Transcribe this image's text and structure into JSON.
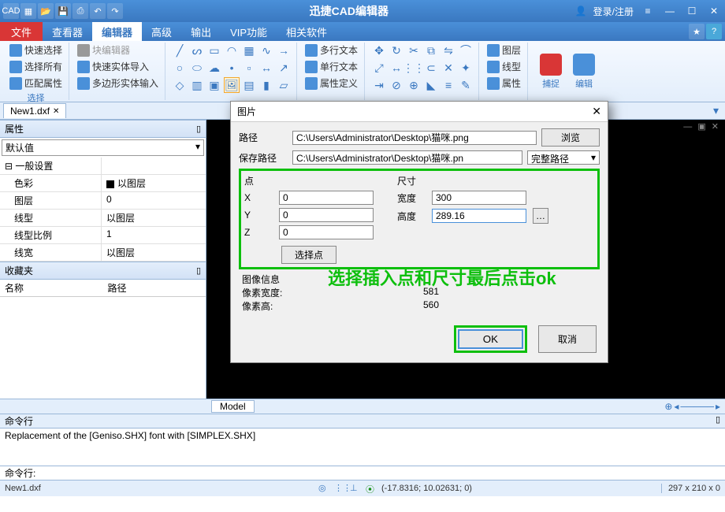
{
  "titlebar": {
    "app_title": "迅捷CAD编辑器",
    "login": "登录/注册"
  },
  "menubar": {
    "file": "文件",
    "tabs": [
      "查看器",
      "编辑器",
      "高级",
      "输出",
      "VIP功能",
      "相关软件"
    ],
    "active_index": 1
  },
  "ribbon": {
    "sel1": "快速选择",
    "sel2": "选择所有",
    "sel3": "匹配属性",
    "sel_grp": "选择",
    "blk1": "块编辑器",
    "blk2": "快速实体导入",
    "blk3": "多边形实体输入",
    "txt1": "多行文本",
    "txt2": "单行文本",
    "txt3": "属性定义",
    "layer1": "图层",
    "layer2": "线型",
    "layer3": "属性",
    "capture": "捕捉",
    "edit": "编辑"
  },
  "doctab": {
    "name": "New1.dxf"
  },
  "props": {
    "header": "属性",
    "default": "默认值",
    "section": "一般设置",
    "rows": [
      {
        "label": "色彩",
        "val": "以图层",
        "swatch": true
      },
      {
        "label": "图层",
        "val": "0"
      },
      {
        "label": "线型",
        "val": "以图层"
      },
      {
        "label": "线型比例",
        "val": "1"
      },
      {
        "label": "线宽",
        "val": "以图层"
      }
    ]
  },
  "fav": {
    "header": "收藏夹",
    "name_hdr": "名称",
    "path_hdr": "路径"
  },
  "dialog": {
    "title": "图片",
    "path_label": "路径",
    "path_val": "C:\\Users\\Administrator\\Desktop\\猫咪.png",
    "browse": "浏览",
    "save_label": "保存路径",
    "save_val": "C:\\Users\\Administrator\\Desktop\\猫咪.pn",
    "save_combo": "完整路径",
    "point_hdr": "点",
    "size_hdr": "尺寸",
    "x": "X",
    "y": "Y",
    "z": "Z",
    "xv": "0",
    "yv": "0",
    "zv": "0",
    "w_label": "宽度",
    "h_label": "高度",
    "wv": "300",
    "hv": "289.16",
    "select_pt": "选择点",
    "info_hdr": "图像信息",
    "pw_label": "像素宽度:",
    "pw": "581",
    "ph_label": "像素高:",
    "ph": "560",
    "ok": "OK",
    "cancel": "取消"
  },
  "annotation": "选择插入点和尺寸最后点击ok",
  "modelbar": {
    "model": "Model"
  },
  "cmd": {
    "header": "命令行",
    "log": "Replacement of the [Geniso.SHX] font with [SIMPLEX.SHX]",
    "prompt": "命令行:"
  },
  "status": {
    "file": "New1.dxf",
    "coords": "(-17.8316; 10.02631; 0)",
    "dims": "297 x 210 x 0"
  }
}
